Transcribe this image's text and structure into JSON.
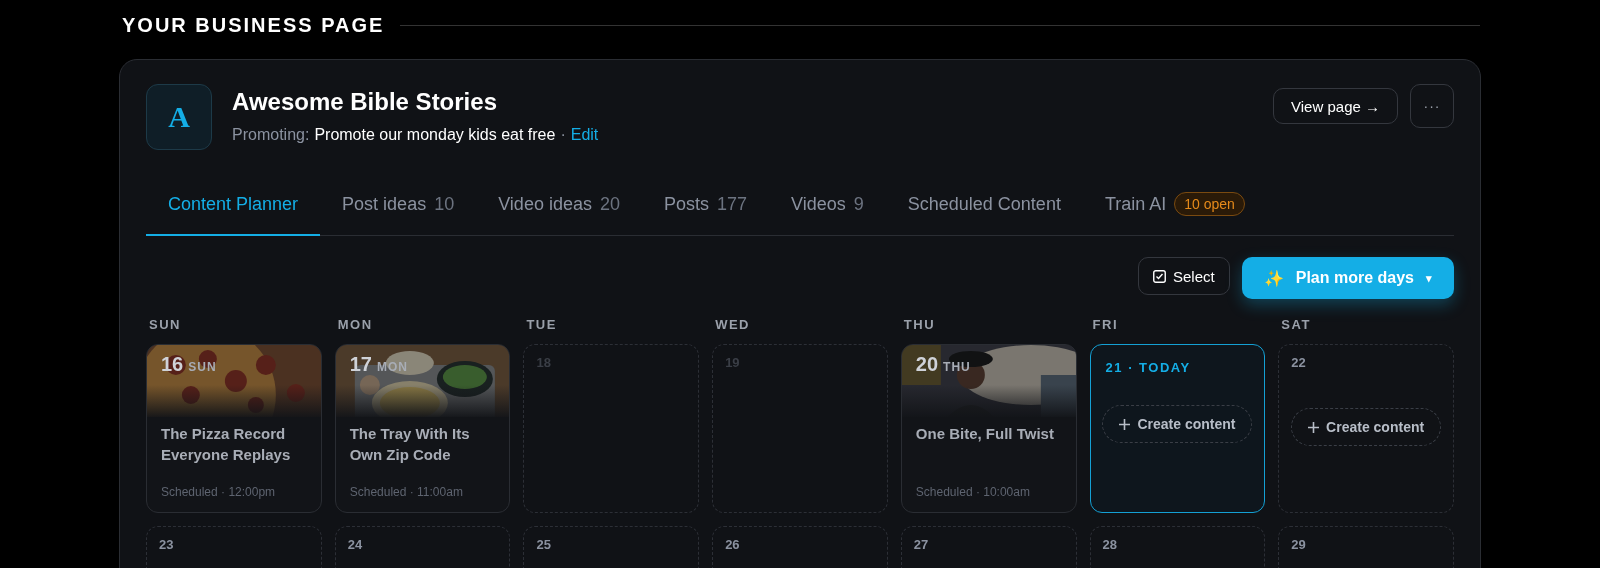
{
  "section_title": "YOUR BUSINESS PAGE",
  "business": {
    "initial": "A",
    "name": "Awesome Bible Stories",
    "promoting_label": "Promoting:",
    "promotion": "Promote our monday kids eat free",
    "separator": "·",
    "edit_link": "Edit"
  },
  "header_buttons": {
    "view_page": "View page →",
    "more": "···"
  },
  "tabs": [
    {
      "label": "Content Planner",
      "selected": true
    },
    {
      "label": "Post ideas",
      "count": "10",
      "selected": false
    },
    {
      "label": "Video ideas",
      "count": "20",
      "selected": false
    },
    {
      "label": "Posts",
      "count": "177",
      "selected": false
    },
    {
      "label": "Videos",
      "count": "9",
      "selected": false
    },
    {
      "label": "Scheduled Content",
      "selected": false
    },
    {
      "label": "Train AI",
      "badge": "10 open",
      "selected": false
    }
  ],
  "toolbar": {
    "select": "Select",
    "plan": "Plan more days",
    "plan_icon": "✨",
    "plan_caret": "▾"
  },
  "weekdays": [
    "SUN",
    "MON",
    "TUE",
    "WED",
    "THU",
    "FRI",
    "SAT"
  ],
  "weeks": [
    [
      {
        "kind": "post",
        "day": "16",
        "weekday": "SUN",
        "title": "The Pizza Record Everyone Replays",
        "status": "Scheduled · 12:00pm"
      },
      {
        "kind": "post",
        "day": "17",
        "weekday": "MON",
        "title": "The Tray With Its Own Zip Code",
        "status": "Scheduled · 11:00am"
      },
      {
        "kind": "past",
        "day": "18"
      },
      {
        "kind": "past",
        "day": "19"
      },
      {
        "kind": "post",
        "day": "20",
        "weekday": "THU",
        "title": "One Bite, Full Twist",
        "status": "Scheduled · 10:00am"
      },
      {
        "kind": "today",
        "day": "21 · TODAY",
        "action": "Create content"
      },
      {
        "kind": "future",
        "day": "22",
        "action": "Create content"
      }
    ],
    [
      {
        "kind": "future",
        "day": "23"
      },
      {
        "kind": "future",
        "day": "24"
      },
      {
        "kind": "future",
        "day": "25"
      },
      {
        "kind": "future",
        "day": "26"
      },
      {
        "kind": "future",
        "day": "27"
      },
      {
        "kind": "future",
        "day": "28"
      },
      {
        "kind": "future",
        "day": "29"
      }
    ]
  ]
}
